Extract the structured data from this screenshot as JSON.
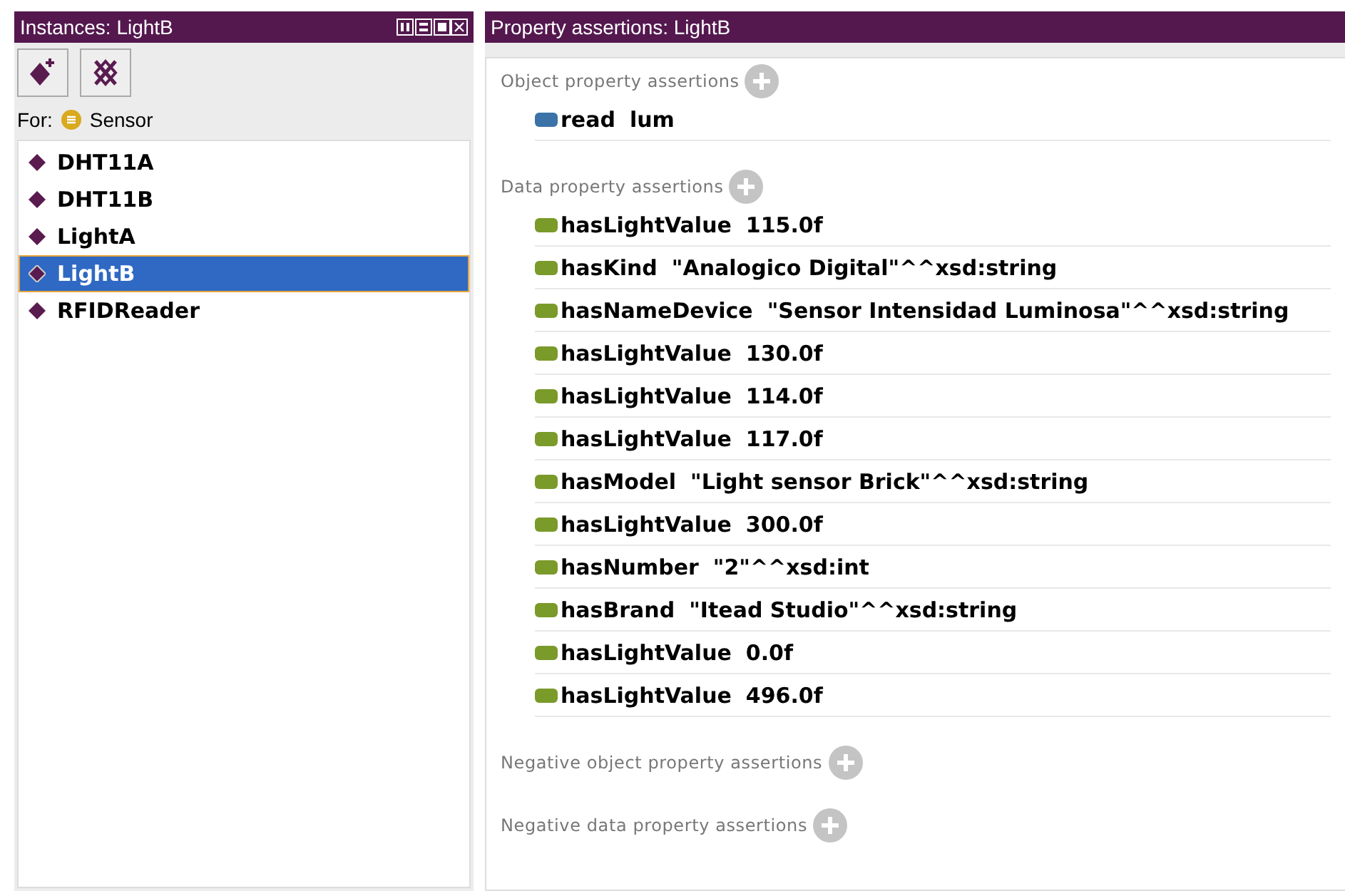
{
  "instances_panel": {
    "title": "Instances: LightB",
    "for_label": "For:",
    "for_class": "Sensor",
    "items": [
      {
        "label": "DHT11A",
        "selected": false
      },
      {
        "label": "DHT11B",
        "selected": false
      },
      {
        "label": "LightA",
        "selected": false
      },
      {
        "label": "LightB",
        "selected": true
      },
      {
        "label": "RFIDReader",
        "selected": false
      }
    ]
  },
  "assertions_panel": {
    "title": "Property assertions: LightB",
    "sections": [
      {
        "heading": "Object property assertions",
        "kind": "object",
        "rows": [
          {
            "property": "read",
            "value": "lum"
          }
        ]
      },
      {
        "heading": "Data property assertions",
        "kind": "data",
        "rows": [
          {
            "property": "hasLightValue",
            "value": "115.0f"
          },
          {
            "property": "hasKind",
            "value": "\"Analogico Digital\"^^xsd:string"
          },
          {
            "property": "hasNameDevice",
            "value": "\"Sensor Intensidad Luminosa\"^^xsd:string"
          },
          {
            "property": "hasLightValue",
            "value": "130.0f"
          },
          {
            "property": "hasLightValue",
            "value": "114.0f"
          },
          {
            "property": "hasLightValue",
            "value": "117.0f"
          },
          {
            "property": "hasModel",
            "value": "\"Light sensor Brick\"^^xsd:string"
          },
          {
            "property": "hasLightValue",
            "value": "300.0f"
          },
          {
            "property": "hasNumber",
            "value": "\"2\"^^xsd:int"
          },
          {
            "property": "hasBrand",
            "value": "\"Itead Studio\"^^xsd:string"
          },
          {
            "property": "hasLightValue",
            "value": "0.0f"
          },
          {
            "property": "hasLightValue",
            "value": "496.0f"
          }
        ]
      },
      {
        "heading": "Negative object property assertions"
      },
      {
        "heading": "Negative data property assertions"
      }
    ]
  }
}
